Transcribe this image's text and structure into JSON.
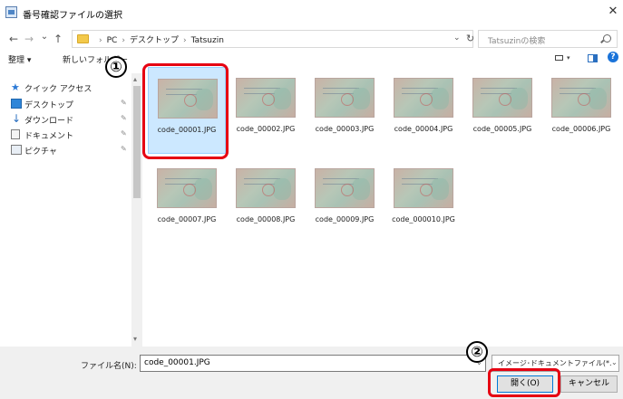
{
  "window": {
    "title": "番号確認ファイルの選択",
    "close_glyph": "✕"
  },
  "address": {
    "back_glyph": "←",
    "forward_glyph": "→",
    "recent_glyph": "⌄",
    "up_glyph": "↑",
    "crumbs": [
      "PC",
      "デスクトップ",
      "Tatsuzin"
    ],
    "separator": "›",
    "search_placeholder": "Tatsuzinの検索"
  },
  "toolbar": {
    "organize": "整理 ▾",
    "new_folder": "新しいフォルダー"
  },
  "nav": {
    "items": [
      {
        "label": "クイック アクセス",
        "icon": "star-icon",
        "pinned": false
      },
      {
        "label": "デスクトップ",
        "icon": "desktop-icon",
        "pinned": true
      },
      {
        "label": "ダウンロード",
        "icon": "download-icon",
        "pinned": true
      },
      {
        "label": "ドキュメント",
        "icon": "document-icon",
        "pinned": true
      },
      {
        "label": "ピクチャ",
        "icon": "pictures-icon",
        "pinned": true
      }
    ],
    "pin_glyph": "✎"
  },
  "files": [
    {
      "name": "code_00001.JPG",
      "selected": true
    },
    {
      "name": "code_00002.JPG",
      "selected": false
    },
    {
      "name": "code_00003.JPG",
      "selected": false
    },
    {
      "name": "code_00004.JPG",
      "selected": false
    },
    {
      "name": "code_00005.JPG",
      "selected": false
    },
    {
      "name": "code_00006.JPG",
      "selected": false
    },
    {
      "name": "code_00007.JPG",
      "selected": false
    },
    {
      "name": "code_00008.JPG",
      "selected": false
    },
    {
      "name": "code_00009.JPG",
      "selected": false
    },
    {
      "name": "code_000010.JPG",
      "selected": false
    }
  ],
  "bottom": {
    "filename_label": "ファイル名(N):",
    "filename_value": "code_00001.JPG",
    "filter_value": "イメージ･ドキュメントファイル(*.jpg;*.",
    "open_button": "開く(O)",
    "cancel_button": "キャンセル"
  },
  "annotations": {
    "step1": "①",
    "step2": "②",
    "highlight_color": "#e60012"
  }
}
